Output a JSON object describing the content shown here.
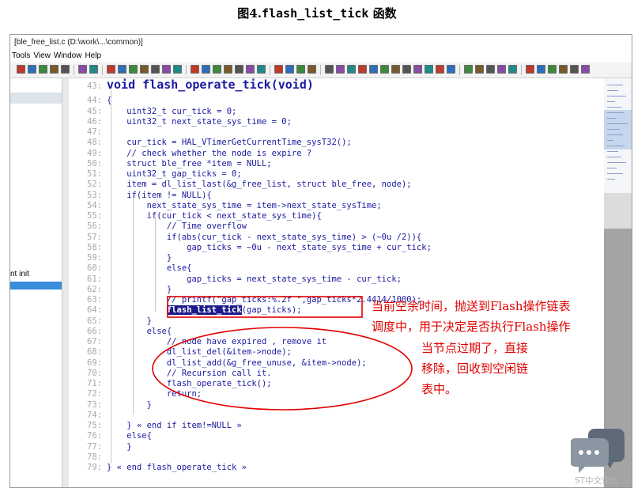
{
  "figure": {
    "caption_prefix": "图4.",
    "caption_code": "flash_list_tick",
    "caption_suffix": "函数"
  },
  "window": {
    "title": "[ble_free_list.c (D:\\work\\...\\common)]",
    "menu": [
      "Tools",
      "View",
      "Window",
      "Help"
    ]
  },
  "sidebar": {
    "item_label": "nt init"
  },
  "code": {
    "lines": [
      {
        "n": "43:",
        "t": "void flash_operate_tick(void)"
      },
      {
        "n": "44:",
        "t": "{"
      },
      {
        "n": "45:",
        "t": "    uint32_t cur_tick = 0;"
      },
      {
        "n": "46:",
        "t": "    uint32_t next_state_sys_time = 0;"
      },
      {
        "n": "47:",
        "t": ""
      },
      {
        "n": "48:",
        "t": "    cur_tick = HAL_VTimerGetCurrentTime_sysT32();"
      },
      {
        "n": "49:",
        "t": "    // check whether the node is expire ?"
      },
      {
        "n": "50:",
        "t": "    struct ble_free *item = NULL;"
      },
      {
        "n": "51:",
        "t": "    uint32_t gap_ticks = 0;"
      },
      {
        "n": "52:",
        "t": "    item = dl_list_last(&g_free_list, struct ble_free, node);"
      },
      {
        "n": "53:",
        "t": "    if(item != NULL){"
      },
      {
        "n": "54:",
        "t": "        next_state_sys_time = item->next_state_sysTime;"
      },
      {
        "n": "55:",
        "t": "        if(cur_tick < next_state_sys_time){"
      },
      {
        "n": "56:",
        "t": "            // Time overflow"
      },
      {
        "n": "57:",
        "t": "            if(abs(cur_tick - next_state_sys_time) > (~0u /2)){"
      },
      {
        "n": "58:",
        "t": "                gap_ticks = ~0u - next_state_sys_time + cur_tick;"
      },
      {
        "n": "59:",
        "t": "            }"
      },
      {
        "n": "60:",
        "t": "            else{"
      },
      {
        "n": "61:",
        "t": "                gap_ticks = next_state_sys_time - cur_tick;"
      },
      {
        "n": "62:",
        "t": "            }"
      },
      {
        "n": "63:",
        "t": "            // printf(\"gap_ticks:%.2f \",gap_ticks*2.4414/1000);"
      },
      {
        "n": "64:",
        "t": "(gap_ticks);",
        "hl": "flash_list_tick"
      },
      {
        "n": "65:",
        "t": "        }"
      },
      {
        "n": "66:",
        "t": "        else{"
      },
      {
        "n": "67:",
        "t": "            // node have expired , remove it"
      },
      {
        "n": "68:",
        "t": "            dl_list_del(&item->node);"
      },
      {
        "n": "69:",
        "t": "            dl_list_add(&g_free_unuse, &item->node);"
      },
      {
        "n": "70:",
        "t": "            // Recursion call it."
      },
      {
        "n": "71:",
        "t": "            flash_operate_tick();"
      },
      {
        "n": "72:",
        "t": "            return;"
      },
      {
        "n": "73:",
        "t": "        }"
      },
      {
        "n": "74:",
        "t": ""
      },
      {
        "n": "75:",
        "t": "    } « end if item!=NULL »"
      },
      {
        "n": "76:",
        "t": "    else{"
      },
      {
        "n": "77:",
        "t": "    }"
      },
      {
        "n": "78:",
        "t": ""
      },
      {
        "n": "79:",
        "t": "} « end flash_operate_tick »"
      }
    ]
  },
  "annotations": {
    "box_note_1": "当前空余时间，抛送到Flash操作链表",
    "box_note_2": "调度中，用于决定是否执行Flash操作",
    "ellipse_note_1": "当节点过期了，直接",
    "ellipse_note_2": "移除，回收到空闲链",
    "ellipse_note_3": "表中。",
    "color": "#e00000"
  },
  "watermark": {
    "text": "ST中文论坛",
    "icon": "chat-bubble-icon"
  }
}
